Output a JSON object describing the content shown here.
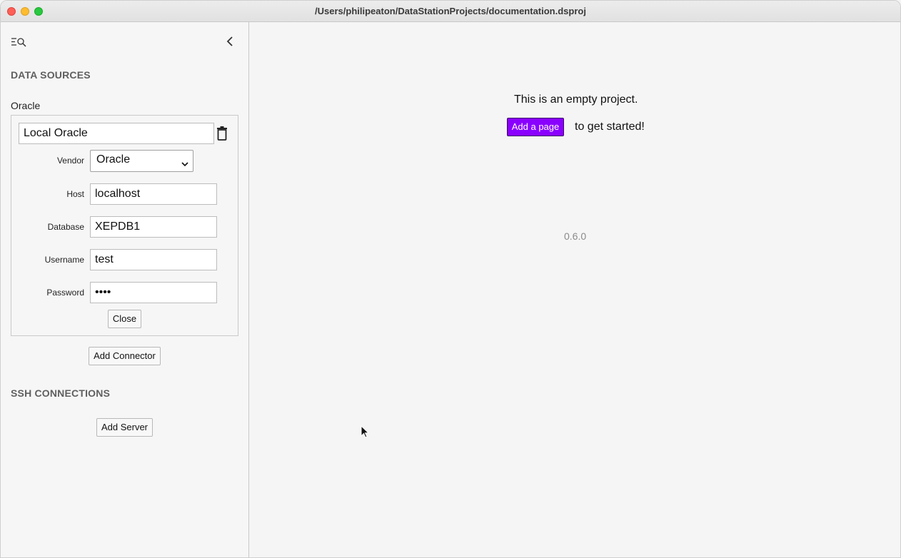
{
  "window": {
    "title": "/Users/philipeaton/DataStationProjects/documentation.dsproj"
  },
  "sidebar": {
    "data_sources_title": "DATA SOURCES",
    "source_type": "Oracle",
    "connector": {
      "name": "Local Oracle",
      "vendor_label": "Vendor",
      "vendor_value": "Oracle",
      "host_label": "Host",
      "host_value": "localhost",
      "database_label": "Database",
      "database_value": "XEPDB1",
      "username_label": "Username",
      "username_value": "test",
      "password_label": "Password",
      "password_value": "••••",
      "close_label": "Close"
    },
    "add_connector_label": "Add Connector",
    "ssh_title": "SSH CONNECTIONS",
    "add_server_label": "Add Server"
  },
  "main": {
    "empty_text": "This is an empty project.",
    "add_page_label": "Add a page",
    "get_started_text": "to get started!",
    "version": "0.6.0"
  },
  "colors": {
    "accent": "#8a00ff",
    "section_title": "#5f5f5f",
    "version_text": "#8a8a8a"
  },
  "icons": {
    "sidebar_toggle": "list-search-icon",
    "collapse": "chevron-left-icon",
    "delete": "trash-icon",
    "select": "chevron-down-icon",
    "pointer": "mouse-cursor-icon"
  }
}
